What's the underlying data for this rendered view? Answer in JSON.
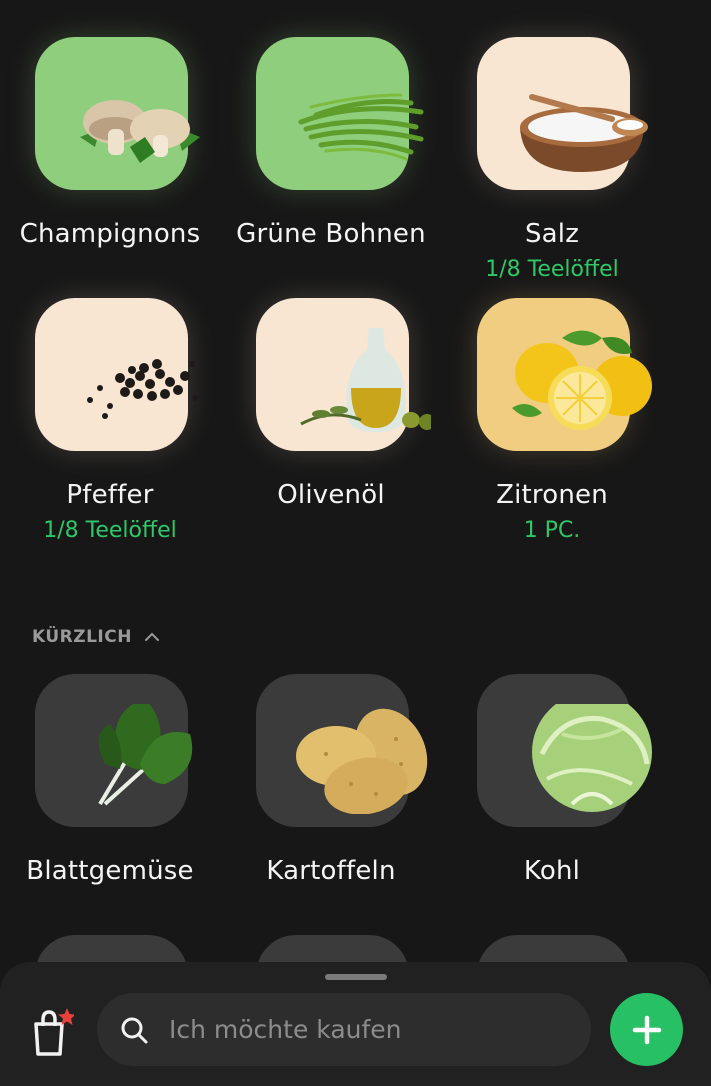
{
  "ingredients": [
    {
      "name": "Champignons",
      "qty": "",
      "tile": "green",
      "icon": "mushroom-icon"
    },
    {
      "name": "Grüne Bohnen",
      "qty": "",
      "tile": "green",
      "icon": "green-beans-icon"
    },
    {
      "name": "Salz",
      "qty": "1/8 Teelöffel",
      "tile": "cream",
      "icon": "salt-bowl-icon"
    },
    {
      "name": "Pfeffer",
      "qty": "1/8 Teelöffel",
      "tile": "cream",
      "icon": "peppercorn-icon"
    },
    {
      "name": "Olivenöl",
      "qty": "",
      "tile": "cream",
      "icon": "olive-oil-icon"
    },
    {
      "name": "Zitronen",
      "qty": "1 PC.",
      "tile": "yellow",
      "icon": "lemon-icon"
    }
  ],
  "recent": {
    "label": "KÜRZLICH",
    "items": [
      {
        "name": "Blattgemüse",
        "icon": "leafy-greens-icon"
      },
      {
        "name": "Kartoffeln",
        "icon": "potato-icon"
      },
      {
        "name": "Kohl",
        "icon": "cabbage-icon"
      }
    ]
  },
  "bottom_bar": {
    "search_placeholder": "Ich möchte kaufen"
  },
  "colors": {
    "background": "#171717",
    "accent_green": "#27c064",
    "quantity_green": "#2ec867",
    "tile_green": "#8fce7d",
    "tile_cream": "#f8e5d2",
    "tile_yellow": "#f1cd82",
    "tile_dark": "#3b3b3b"
  }
}
